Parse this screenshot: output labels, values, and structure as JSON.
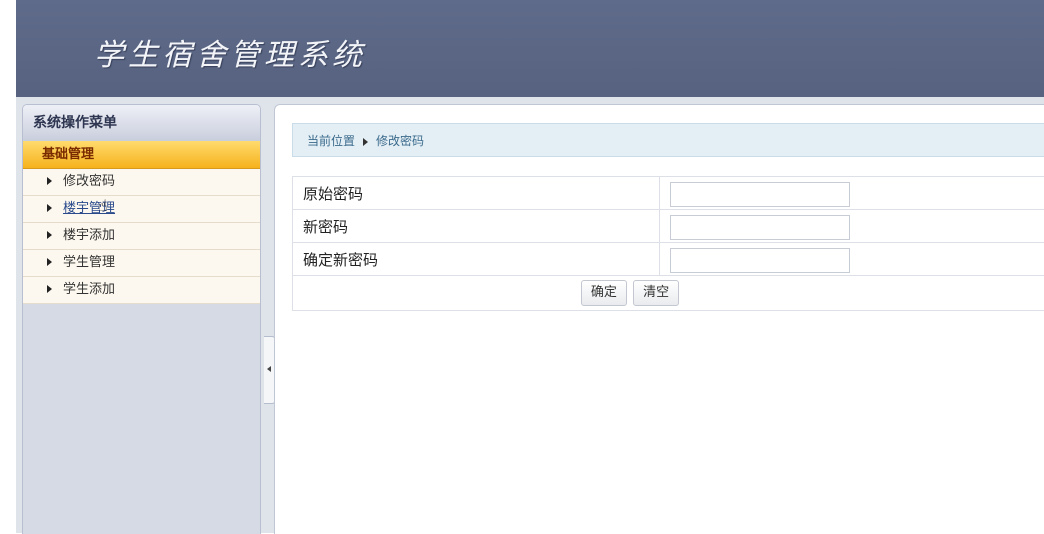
{
  "header": {
    "app_title": "学生宿舍管理系统"
  },
  "sidebar": {
    "title": "系统操作菜单",
    "group": "基础管理",
    "items": [
      {
        "label": "修改密码"
      },
      {
        "label": "楼宇管理"
      },
      {
        "label": "楼宇添加"
      },
      {
        "label": "学生管理"
      },
      {
        "label": "学生添加"
      }
    ]
  },
  "breadcrumb": {
    "prefix": "当前位置",
    "current": "修改密码"
  },
  "form": {
    "fields": [
      {
        "label": "原始密码",
        "value": ""
      },
      {
        "label": "新密码",
        "value": ""
      },
      {
        "label": "确定新密码",
        "value": ""
      }
    ],
    "submit_label": "确定",
    "reset_label": "清空"
  },
  "colors": {
    "header_bg": "#5f6b8a",
    "menu_group_bg": "#f6b21c",
    "breadcrumb_bg": "#e3eef5"
  }
}
